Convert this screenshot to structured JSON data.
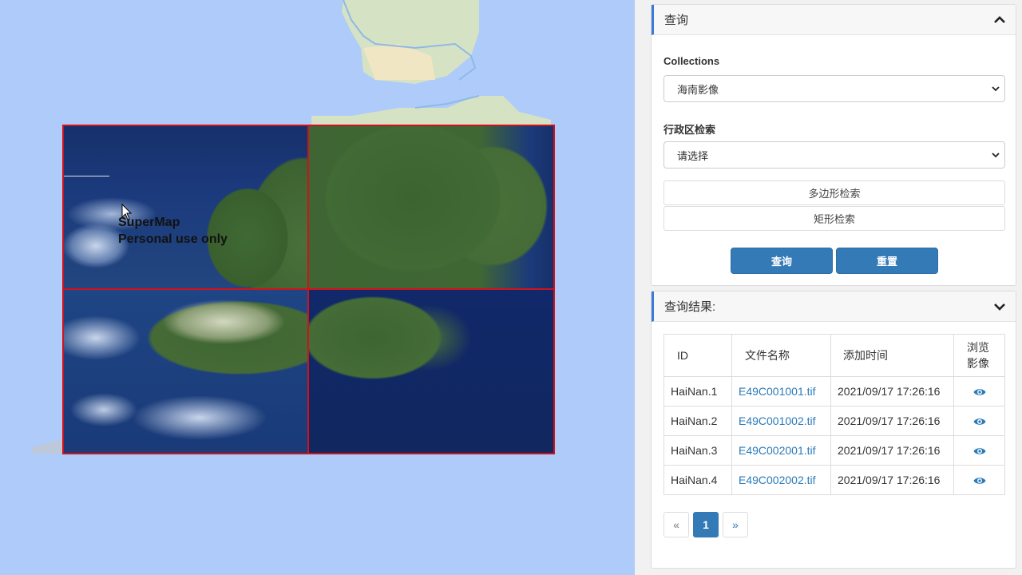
{
  "map": {
    "watermark_line1": "SuperMap",
    "watermark_line2": "Personal use only"
  },
  "query_panel": {
    "title": "查询",
    "collections_label": "Collections",
    "collections_value": "海南影像",
    "region_label": "行政区检索",
    "region_value": "请选择",
    "polygon_search": "多边形检索",
    "rect_search": "矩形检索",
    "query_button": "查询",
    "reset_button": "重置"
  },
  "result_panel": {
    "title": "查询结果:",
    "columns": [
      "ID",
      "文件名称",
      "添加时间",
      "浏览影像"
    ],
    "rows": [
      {
        "id": "HaiNan.1",
        "file": "E49C001001.tif",
        "time": "2021/09/17 17:26:16"
      },
      {
        "id": "HaiNan.2",
        "file": "E49C001002.tif",
        "time": "2021/09/17 17:26:16"
      },
      {
        "id": "HaiNan.3",
        "file": "E49C002001.tif",
        "time": "2021/09/17 17:26:16"
      },
      {
        "id": "HaiNan.4",
        "file": "E49C002002.tif",
        "time": "2021/09/17 17:26:16"
      }
    ],
    "pagination": {
      "prev": "«",
      "current": "1",
      "next": "»"
    }
  },
  "colors": {
    "accent": "#337ab7",
    "tile_border": "#d0121b",
    "link": "#2a7ab8"
  }
}
